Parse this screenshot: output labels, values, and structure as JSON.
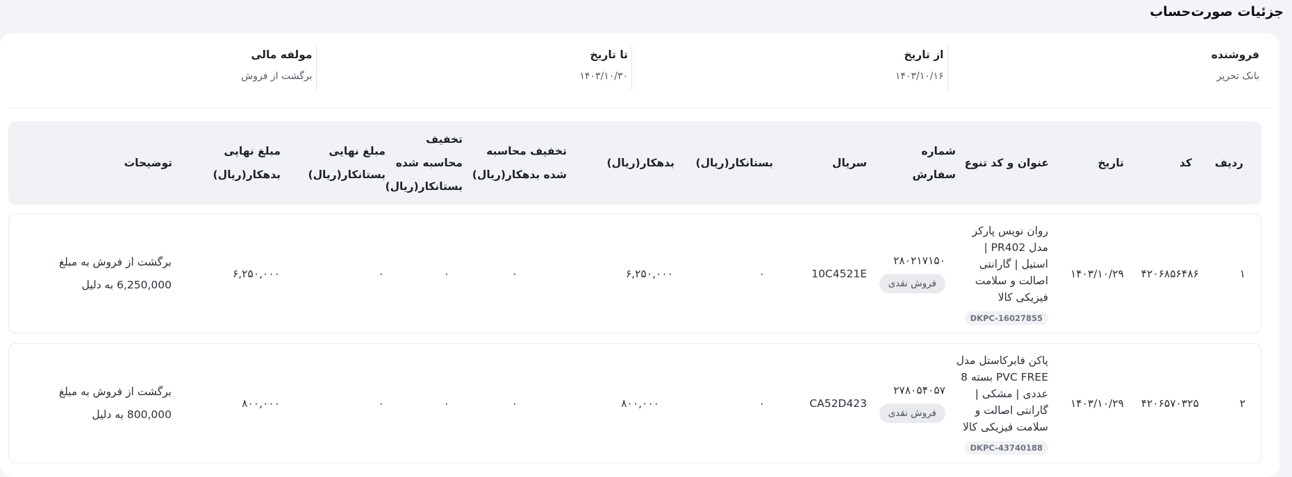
{
  "page": {
    "title": "جزئیات صورت‌حساب"
  },
  "summary": [
    {
      "label": "فروشنده",
      "value": "بانک تحریر"
    },
    {
      "label": "از تاریخ",
      "value": "۱۴۰۳/۱۰/۱۶"
    },
    {
      "label": "تا تاریخ",
      "value": "۱۴۰۳/۱۰/۳۰"
    },
    {
      "label": "مولفه مالی",
      "value": "برگشت از فروش"
    }
  ],
  "table": {
    "headers": {
      "row": "ردیف",
      "code": "کد",
      "date": "تاریخ",
      "title": "عنوان و کد تنوع",
      "order_1": "شماره",
      "order_2": "سفارش",
      "serial": "سریال",
      "creditor": "بستانکار(ریال)",
      "debtor": "بدهکار(ریال)",
      "disc_debtor_1": "تخفیف محاسبه",
      "disc_debtor_2": "شده بدهکار(ریال)",
      "disc_creditor_1": "تخفیف",
      "disc_creditor_2": "محاسبه شده",
      "disc_creditor_3": "بستانکار(ریال)",
      "final_creditor_1": "مبلغ نهایی",
      "final_creditor_2": "بستانکار(ریال)",
      "final_debtor_1": "مبلغ نهایی",
      "final_debtor_2": "بدهکار(ریال)",
      "description": "توضیحات"
    },
    "rows": [
      {
        "row": "۱",
        "code": "۴۲۰۶۸۵۶۴۸۶",
        "date": "۱۴۰۳/۱۰/۲۹",
        "title_lines": [
          "روان نویس پارکر",
          "مدل PR402 |",
          "استیل | گارانتی",
          "اصالت و سلامت",
          "فیزیکی کالا"
        ],
        "sku": "DKPC-16027855",
        "order_no": "۲۸۰۲۱۷۱۵۰",
        "payment": "فروش نقدی",
        "serial": "10C4521E",
        "creditor": "۰",
        "debtor": "۶,۲۵۰,۰۰۰",
        "disc_debtor": "۰",
        "disc_creditor": "۰",
        "final_creditor": "۰",
        "final_debtor": "۶,۲۵۰,۰۰۰",
        "description_lines": [
          "برگشت از فروش به مبلغ",
          "6,250,000 به دلیل"
        ]
      },
      {
        "row": "۲",
        "code": "۴۲۰۶۵۷۰۳۲۵",
        "date": "۱۴۰۳/۱۰/۲۹",
        "title_lines": [
          "پاکن فابرکاستل مدل",
          "PVC FREE بسته 8",
          "عددی | مشکی |",
          "گارانتی اصالت و",
          "سلامت فیزیکی کالا"
        ],
        "sku": "DKPC-43740188",
        "order_no": "۲۷۸۰۵۴۰۵۷",
        "payment": "فروش نقدی",
        "serial": "CA52D423",
        "creditor": "۰",
        "debtor": "۸۰۰,۰۰۰",
        "disc_debtor": "۰",
        "disc_creditor": "۰",
        "final_creditor": "۰",
        "final_debtor": "۸۰۰,۰۰۰",
        "description_lines": [
          "برگشت از فروش به مبلغ",
          "800,000 به دلیل"
        ]
      }
    ]
  }
}
